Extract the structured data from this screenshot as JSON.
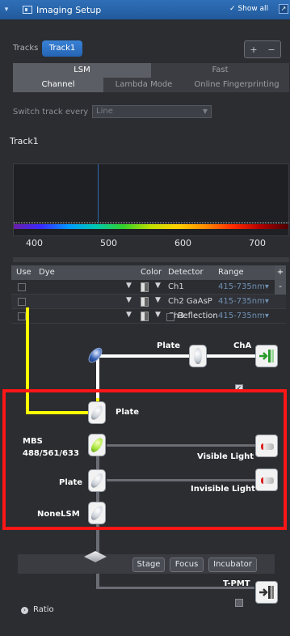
{
  "window": {
    "title": "Imaging Setup",
    "show_all": "✓ Show all"
  },
  "tracks": {
    "label": "Tracks",
    "items": [
      "Track1"
    ],
    "add": "+",
    "remove": "−"
  },
  "mode_tabs": [
    "LSM",
    "Fast"
  ],
  "sub_tabs": [
    "Channel",
    "Lambda Mode",
    "Online Fingerprinting"
  ],
  "switch_track": {
    "label": "Switch track every",
    "value": "Line"
  },
  "track_title": "Track1",
  "spectrum": {
    "ticks": [
      "400",
      "500",
      "600",
      "700"
    ]
  },
  "dye_table": {
    "headers": {
      "use": "Use",
      "dye": "Dye",
      "color": "Color",
      "detector": "Detector",
      "range": "Range"
    },
    "add": "+",
    "remove": "-",
    "rows": [
      {
        "detector": "Ch1",
        "range": "415-735nm▾"
      },
      {
        "detector": "Ch2 GaAsP",
        "range": "415-735nm▾"
      },
      {
        "detector": "Ch3",
        "range": "415-735nm▾"
      }
    ]
  },
  "reflection": "Reflection",
  "diagram": {
    "plate_top": "Plate",
    "cha": "ChA",
    "plate_mid": "Plate",
    "mbs_line1": "MBS",
    "mbs_line2": "488/561/633",
    "visible_light": "Visible Light",
    "plate_low": "Plate",
    "invisible_light": "Invisible Light",
    "none_lsm": "NoneLSM",
    "tpmt": "T-PMT"
  },
  "buttons": {
    "stage": "Stage",
    "focus": "Focus",
    "incubator": "Incubator"
  },
  "ratio": "Ratio",
  "colors": {
    "accent": "#2a6fc1",
    "beam": "#ffff00",
    "highlight": "#ff1616"
  }
}
